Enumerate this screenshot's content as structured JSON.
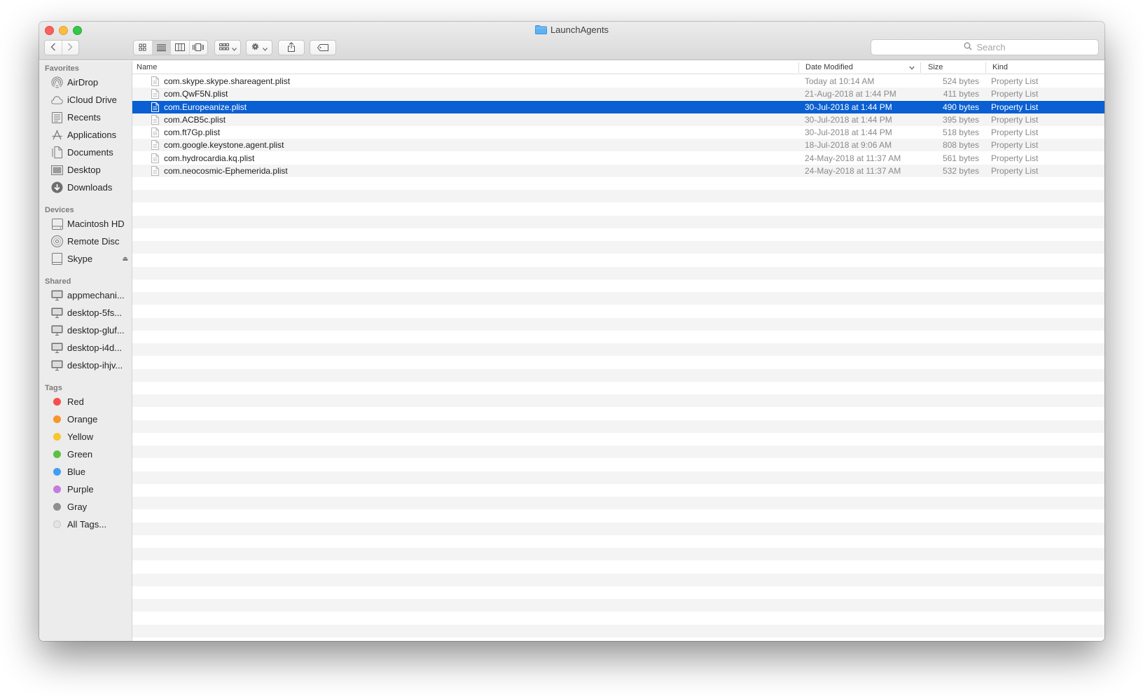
{
  "window": {
    "title": "LaunchAgents"
  },
  "toolbar": {
    "back_icon": "chevron-left-icon",
    "forward_icon": "chevron-right-icon",
    "view_modes": [
      "icon-view",
      "list-view",
      "column-view",
      "cover-flow-view"
    ],
    "active_view": "list-view",
    "group_icon": "arrange-icon",
    "action_icon": "gear-icon",
    "share_icon": "share-icon",
    "tag_icon": "tag-icon"
  },
  "search": {
    "placeholder": "Search"
  },
  "sidebar": {
    "favorites": {
      "label": "Favorites",
      "items": [
        {
          "label": "AirDrop",
          "icon": "airdrop-icon"
        },
        {
          "label": "iCloud Drive",
          "icon": "cloud-icon"
        },
        {
          "label": "Recents",
          "icon": "recents-icon"
        },
        {
          "label": "Applications",
          "icon": "applications-icon"
        },
        {
          "label": "Documents",
          "icon": "documents-icon"
        },
        {
          "label": "Desktop",
          "icon": "desktop-icon"
        },
        {
          "label": "Downloads",
          "icon": "downloads-icon"
        }
      ]
    },
    "devices": {
      "label": "Devices",
      "items": [
        {
          "label": "Macintosh HD",
          "icon": "hard-drive-icon"
        },
        {
          "label": "Remote Disc",
          "icon": "disc-icon"
        },
        {
          "label": "Skype",
          "icon": "volume-icon"
        }
      ]
    },
    "shared": {
      "label": "Shared",
      "items": [
        {
          "label": "appmechani...",
          "icon": "computer-icon"
        },
        {
          "label": "desktop-5fs...",
          "icon": "computer-icon"
        },
        {
          "label": "desktop-gluf...",
          "icon": "computer-icon"
        },
        {
          "label": "desktop-i4d...",
          "icon": "computer-icon"
        },
        {
          "label": "desktop-ihjv...",
          "icon": "computer-icon"
        }
      ]
    },
    "tags": {
      "label": "Tags",
      "items": [
        {
          "label": "Red",
          "color": "#f74f4a"
        },
        {
          "label": "Orange",
          "color": "#f7962d"
        },
        {
          "label": "Yellow",
          "color": "#f7c531"
        },
        {
          "label": "Green",
          "color": "#5ac243"
        },
        {
          "label": "Blue",
          "color": "#3f9ff4"
        },
        {
          "label": "Purple",
          "color": "#c57ae0"
        },
        {
          "label": "Gray",
          "color": "#8f8f8f"
        },
        {
          "label": "All Tags...",
          "color": "#e4e4e4"
        }
      ]
    }
  },
  "columns": {
    "name": "Name",
    "date": "Date Modified",
    "size": "Size",
    "kind": "Kind"
  },
  "files": [
    {
      "name": "com.skype.skype.shareagent.plist",
      "date": "Today at 10:14 AM",
      "size": "524 bytes",
      "kind": "Property List"
    },
    {
      "name": "com.QwF5N.plist",
      "date": "21-Aug-2018 at 1:44 PM",
      "size": "411 bytes",
      "kind": "Property List"
    },
    {
      "name": "com.Europeanize.plist",
      "date": "30-Jul-2018 at 1:44 PM",
      "size": "490 bytes",
      "kind": "Property List",
      "selected": true
    },
    {
      "name": "com.ACB5c.plist",
      "date": "30-Jul-2018 at 1:44 PM",
      "size": "395 bytes",
      "kind": "Property List"
    },
    {
      "name": "com.ft7Gp.plist",
      "date": "30-Jul-2018 at 1:44 PM",
      "size": "518 bytes",
      "kind": "Property List"
    },
    {
      "name": "com.google.keystone.agent.plist",
      "date": "18-Jul-2018 at 9:06 AM",
      "size": "808 bytes",
      "kind": "Property List"
    },
    {
      "name": "com.hydrocardia.kq.plist",
      "date": "24-May-2018 at 11:37 AM",
      "size": "561 bytes",
      "kind": "Property List"
    },
    {
      "name": "com.neocosmic-Ephemerida.plist",
      "date": "24-May-2018 at 11:37 AM",
      "size": "532 bytes",
      "kind": "Property List"
    }
  ],
  "colors": {
    "selection": "#0a5fd3",
    "stripe": "#f4f4f4"
  }
}
